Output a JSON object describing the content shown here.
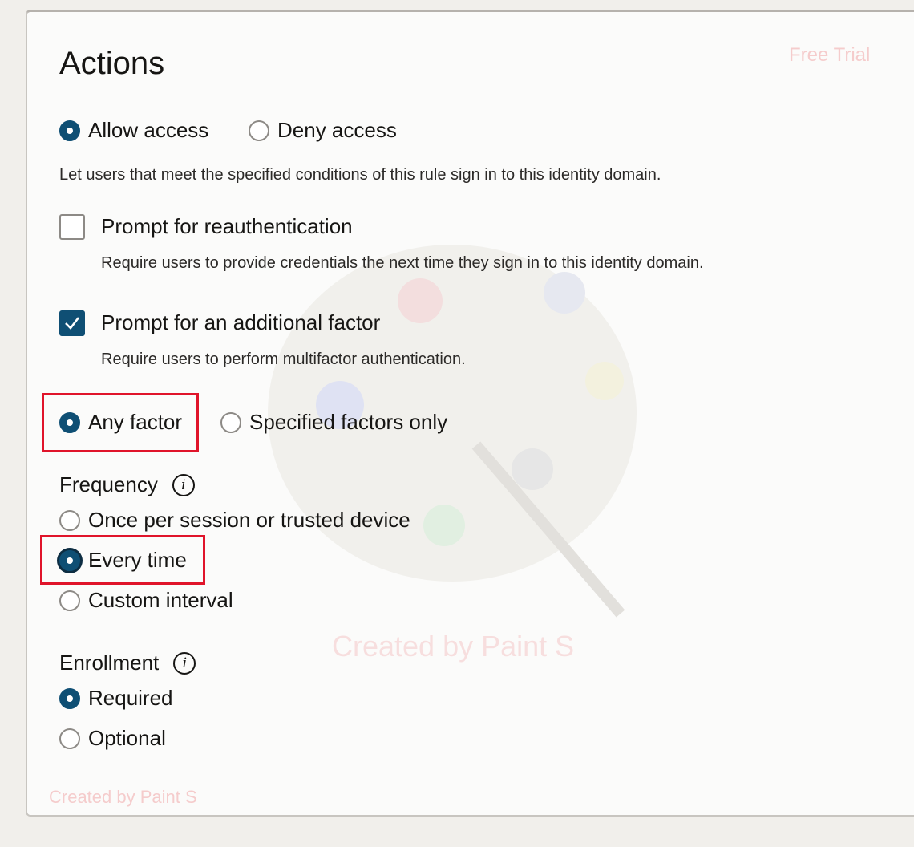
{
  "title": "Actions",
  "watermarks": {
    "free_trial": "Free Trial",
    "center": "Created by Paint S",
    "bottom": "Created by Paint S"
  },
  "access": {
    "options": [
      {
        "label": "Allow access",
        "selected": true
      },
      {
        "label": "Deny access",
        "selected": false
      }
    ],
    "description": "Let users that meet the specified conditions of this rule sign in to this identity domain."
  },
  "reauth": {
    "label": "Prompt for reauthentication",
    "checked": false,
    "description": "Require users to provide credentials the next time they sign in to this identity domain."
  },
  "additional_factor": {
    "label": "Prompt for an additional factor",
    "checked": true,
    "description": "Require users to perform multifactor authentication."
  },
  "factor": {
    "options": [
      {
        "label": "Any factor",
        "selected": true
      },
      {
        "label": "Specified factors only",
        "selected": false
      }
    ]
  },
  "frequency": {
    "label": "Frequency",
    "info_glyph": "i",
    "options": [
      {
        "label": "Once per session or trusted device",
        "selected": false
      },
      {
        "label": "Every time",
        "selected": true
      },
      {
        "label": "Custom interval",
        "selected": false
      }
    ]
  },
  "enrollment": {
    "label": "Enrollment",
    "info_glyph": "i",
    "options": [
      {
        "label": "Required",
        "selected": true
      },
      {
        "label": "Optional",
        "selected": false
      }
    ]
  },
  "colors": {
    "accent": "#0f4f74",
    "highlight": "#e0142a"
  }
}
